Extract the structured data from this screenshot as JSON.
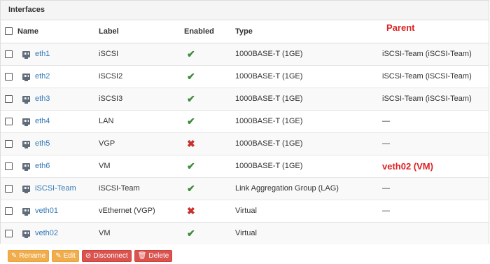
{
  "panel": {
    "title": "Interfaces"
  },
  "columns": {
    "name": "Name",
    "label": "Label",
    "enabled": "Enabled",
    "type": "Type",
    "parent": "Parent"
  },
  "rows": [
    {
      "name": "eth1",
      "label": "iSCSI",
      "enabled": true,
      "type": "1000BASE-T (1GE)",
      "parent": "iSCSI-Team (iSCSI-Team)",
      "parent_style": "link"
    },
    {
      "name": "eth2",
      "label": "iSCSI2",
      "enabled": true,
      "type": "1000BASE-T (1GE)",
      "parent": "iSCSI-Team (iSCSI-Team)",
      "parent_style": "link"
    },
    {
      "name": "eth3",
      "label": "iSCSI3",
      "enabled": true,
      "type": "1000BASE-T (1GE)",
      "parent": "iSCSI-Team (iSCSI-Team)",
      "parent_style": "link"
    },
    {
      "name": "eth4",
      "label": "LAN",
      "enabled": true,
      "type": "1000BASE-T (1GE)",
      "parent": "—",
      "parent_style": "text"
    },
    {
      "name": "eth5",
      "label": "VGP",
      "enabled": false,
      "type": "1000BASE-T (1GE)",
      "parent": "—",
      "parent_style": "text"
    },
    {
      "name": "eth6",
      "label": "VM",
      "enabled": true,
      "type": "1000BASE-T (1GE)",
      "parent": "veth02 (VM)",
      "parent_style": "red"
    },
    {
      "name": "iSCSI-Team",
      "label": "iSCSI-Team",
      "enabled": true,
      "type": "Link Aggregation Group (LAG)",
      "parent": "—",
      "parent_style": "text"
    },
    {
      "name": "veth01",
      "label": "vEthernet (VGP)",
      "enabled": false,
      "type": "Virtual",
      "parent": "—",
      "parent_style": "text"
    },
    {
      "name": "veth02",
      "label": "VM",
      "enabled": true,
      "type": "Virtual",
      "parent": "",
      "parent_style": "text"
    }
  ],
  "toolbar": {
    "rename": "Rename",
    "edit": "Edit",
    "disconnect": "Disconnect",
    "delete": "Delete"
  },
  "colors": {
    "link": "#337ab7",
    "enabled": "#3c8a3c",
    "disabled": "#c9302c",
    "warning": "#f0ad4e",
    "danger": "#d9534f",
    "annotation": "#dd2222"
  },
  "icons": {
    "interface": "network-port-icon",
    "enabled": "checkmark-icon",
    "disabled": "x-icon"
  }
}
